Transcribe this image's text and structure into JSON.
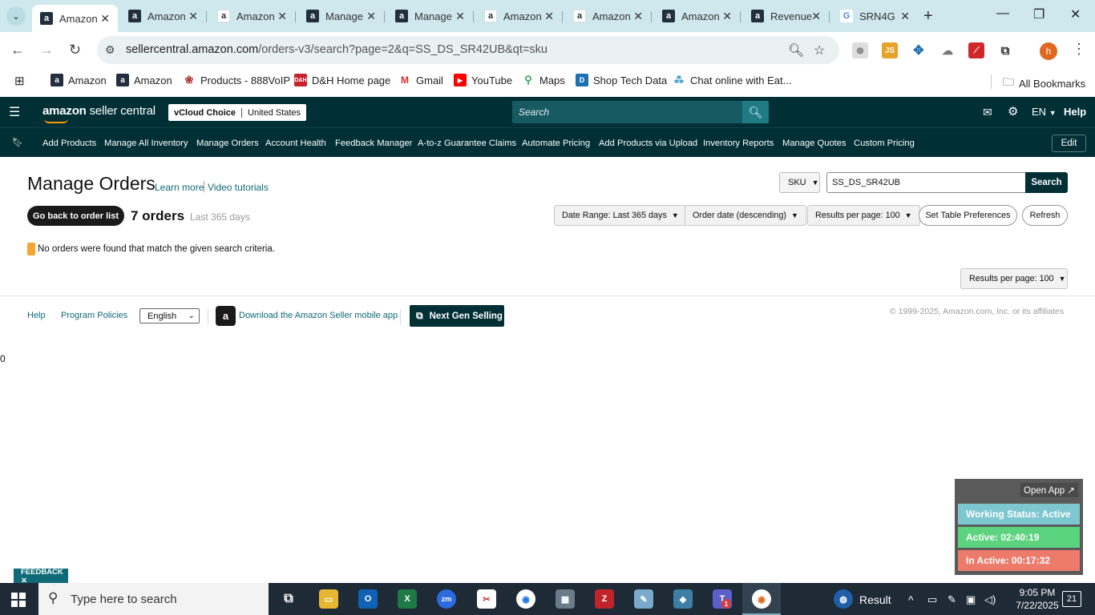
{
  "browser": {
    "tabs": [
      {
        "title": "Amazon",
        "favicon": "amazon-a-icon",
        "active": true
      },
      {
        "title": "Amazon",
        "favicon": "amazon-a-icon"
      },
      {
        "title": "Amazon",
        "favicon": "amazon-smile-icon"
      },
      {
        "title": "Manage",
        "favicon": "amazon-a-icon"
      },
      {
        "title": "Manage",
        "favicon": "amazon-a-icon"
      },
      {
        "title": "Amazon",
        "favicon": "amazon-smile-icon"
      },
      {
        "title": "Amazon",
        "favicon": "amazon-smile-icon"
      },
      {
        "title": "Amazon",
        "favicon": "amazon-a-icon"
      },
      {
        "title": "Revenue",
        "favicon": "amazon-a-icon"
      },
      {
        "title": "SRN4G",
        "favicon": "google-g-icon"
      }
    ],
    "url_host": "sellercentral.amazon.com",
    "url_path": "/orders-v3/search?page=2&q=SS_DS_SR42UB&qt=sku",
    "profile_initial": "h",
    "bookmarks": [
      {
        "label": "Amazon"
      },
      {
        "label": "Amazon"
      },
      {
        "label": "Products - 888VoIP"
      },
      {
        "label": "D&H Home page"
      },
      {
        "label": "Gmail"
      },
      {
        "label": "YouTube"
      },
      {
        "label": "Maps"
      },
      {
        "label": "Shop Tech Data"
      },
      {
        "label": "Chat online with Eat..."
      }
    ],
    "all_bookmarks": "All Bookmarks"
  },
  "header": {
    "logo_bold": "amazon",
    "logo_thin": " seller central",
    "store": "vCloud Choice",
    "marketplace": "United States",
    "search_placeholder": "Search",
    "language": "EN",
    "help": "Help"
  },
  "nav": {
    "items": [
      "Add Products",
      "Manage All Inventory",
      "Manage Orders",
      "Account Health",
      "Feedback Manager",
      "A-to-z Guarantee Claims",
      "Automate Pricing",
      "Add Products via Upload",
      "Inventory Reports",
      "Manage Quotes",
      "Custom Pricing"
    ],
    "edit": "Edit"
  },
  "main": {
    "title": "Manage Orders",
    "learn_more": "Learn more",
    "video_tutorials": "Video tutorials",
    "search_type": "SKU",
    "search_value": "SS_DS_SR42UB",
    "search_button": "Search",
    "back_button": "Go back to order list",
    "order_count": "7 orders",
    "order_range": "Last 365 days",
    "date_range": "Date Range: Last 365 days",
    "sort": "Order date (descending)",
    "results_per_page": "Results per page: 100",
    "set_table_prefs": "Set Table Preferences",
    "refresh": "Refresh",
    "no_results": "No orders were found that match the given search criteria.",
    "results_per_page_bottom": "Results per page: 100"
  },
  "footer": {
    "help": "Help",
    "program_policies": "Program Policies",
    "language": "English",
    "download_app": "Download the Amazon Seller mobile app",
    "next_gen": "Next Gen Selling",
    "copyright": "© 1999-2025, Amazon.com, Inc. or its affiliates",
    "stray_value": "0"
  },
  "status_widget": {
    "open_app": "Open App ↗",
    "working_status": "Working Status: Active",
    "active": "Active: 02:40:19",
    "inactive": "In Active: 00:17:32",
    "colors": {
      "status": "#7ec7d1",
      "active": "#5bd37f",
      "inactive": "#ec7b6c"
    }
  },
  "feedback": "FEEDBACK ✕",
  "taskbar": {
    "search_placeholder": "Type here to search",
    "tray_label": "Result",
    "time": "9:05 PM",
    "date": "7/22/2025",
    "notifications": "21",
    "teams_badge": "1"
  }
}
